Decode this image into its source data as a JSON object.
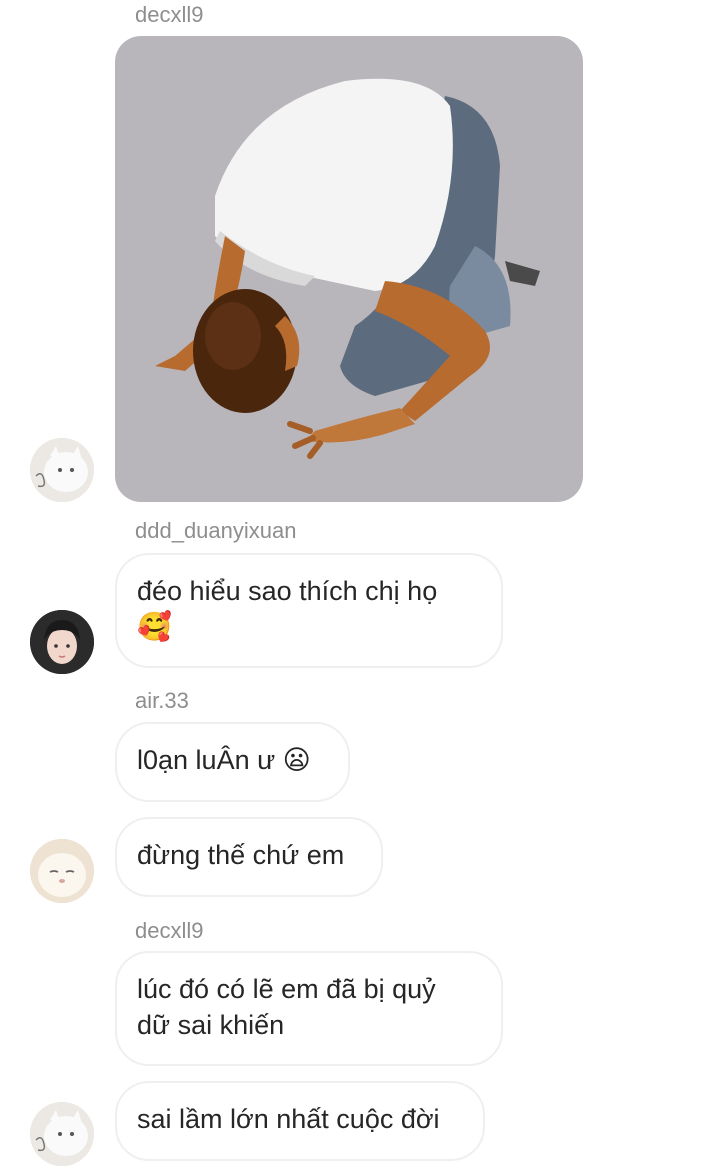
{
  "messages": [
    {
      "sender": "decxll9",
      "type": "image",
      "image_desc": "3d-figure-bowing"
    },
    {
      "sender": "ddd_duanyixuan",
      "text_line1": "đéo hiểu sao thích chị họ",
      "text_line2": "🥰"
    },
    {
      "sender": "air.33",
      "text": "l0ạn luÂn ư 😦"
    },
    {
      "text": "đừng thế chứ em"
    },
    {
      "sender": "decxll9",
      "text_line1": "lúc đó có lẽ em đã bị quỷ",
      "text_line2": "dữ sai khiến"
    },
    {
      "text": "sai lầm lớn nhất cuộc đời"
    }
  ],
  "colors": {
    "bubble_border": "#efefef",
    "sender_text": "#8e8e8e",
    "message_text": "#262626",
    "image_bg": "#b9b6bb"
  }
}
